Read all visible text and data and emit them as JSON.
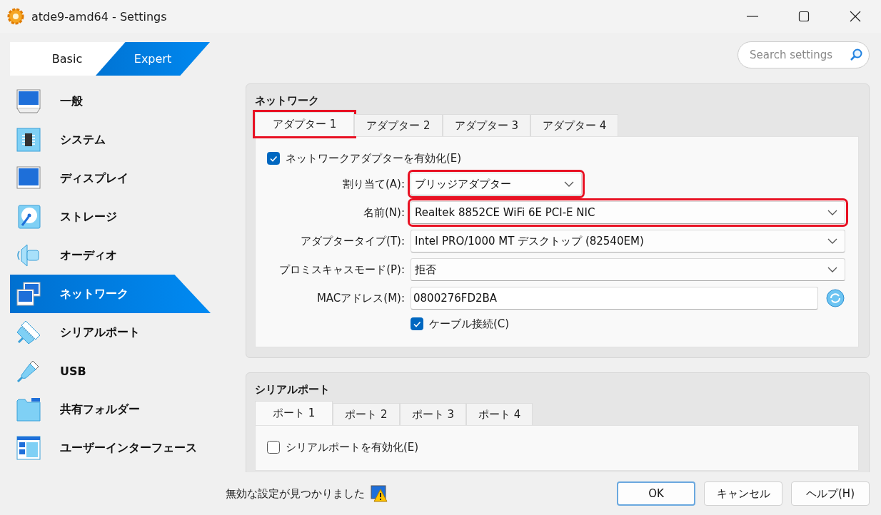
{
  "window": {
    "title": "atde9-amd64 - Settings"
  },
  "mode_tabs": [
    {
      "label": "Basic",
      "selected": false
    },
    {
      "label": "Expert",
      "selected": true
    }
  ],
  "search": {
    "placeholder": "Search settings"
  },
  "sidebar": {
    "items": [
      {
        "label": "一般",
        "kind": "general",
        "selected": false
      },
      {
        "label": "システム",
        "kind": "system",
        "selected": false
      },
      {
        "label": "ディスプレイ",
        "kind": "display",
        "selected": false
      },
      {
        "label": "ストレージ",
        "kind": "storage",
        "selected": false
      },
      {
        "label": "オーディオ",
        "kind": "audio",
        "selected": false
      },
      {
        "label": "ネットワーク",
        "kind": "network",
        "selected": true
      },
      {
        "label": "シリアルポート",
        "kind": "serial",
        "selected": false
      },
      {
        "label": "USB",
        "kind": "usb",
        "selected": false
      },
      {
        "label": "共有フォルダー",
        "kind": "folder",
        "selected": false
      },
      {
        "label": "ユーザーインターフェース",
        "kind": "ui",
        "selected": false
      }
    ]
  },
  "sections": [
    {
      "title": "ネットワーク",
      "tabs": [
        {
          "label": "アダプター 1",
          "selected": true,
          "highlighted": true
        },
        {
          "label": "アダプター 2",
          "selected": false,
          "highlighted": false
        },
        {
          "label": "アダプター 3",
          "selected": false,
          "highlighted": false
        },
        {
          "label": "アダプター 4",
          "selected": false,
          "highlighted": false
        }
      ],
      "rows": [
        {
          "kind": "checkbox",
          "label": "ネットワークアダプターを有効化(E)",
          "checked": true
        },
        {
          "kind": "combo",
          "label": "割り当て(A):",
          "value": "ブリッジアダプター",
          "highlighted": true
        },
        {
          "kind": "select",
          "label": "名前(N):",
          "value": "Realtek 8852CE WiFi 6E PCI-E NIC",
          "highlighted": true
        },
        {
          "kind": "select",
          "label": "アダプタータイプ(T):",
          "value": "Intel PRO/1000 MT デスクトップ (82540EM)",
          "highlighted": false
        },
        {
          "kind": "select",
          "label": "プロミスキャスモード(P):",
          "value": "拒否",
          "highlighted": false
        },
        {
          "kind": "text",
          "label": "MACアドレス(M):",
          "value": "0800276FD2BA"
        },
        {
          "kind": "option",
          "label": "ケーブル接続(C)",
          "checked": true
        }
      ]
    },
    {
      "title": "シリアルポート",
      "tabs": [
        {
          "label": "ポート 1",
          "selected": true,
          "highlighted": false
        },
        {
          "label": "ポート 2",
          "selected": false,
          "highlighted": false
        },
        {
          "label": "ポート 3",
          "selected": false,
          "highlighted": false
        },
        {
          "label": "ポート 4",
          "selected": false,
          "highlighted": false
        }
      ],
      "rows": [
        {
          "kind": "checkbox",
          "label": "シリアルポートを有効化(E)",
          "checked": false
        }
      ]
    }
  ],
  "footer": {
    "message": "無効な設定が見つかりました",
    "buttons": [
      {
        "label": "OK",
        "default": true
      },
      {
        "label": "キャンセル",
        "default": false
      },
      {
        "label": "ヘルプ(H)",
        "default": false
      }
    ]
  }
}
